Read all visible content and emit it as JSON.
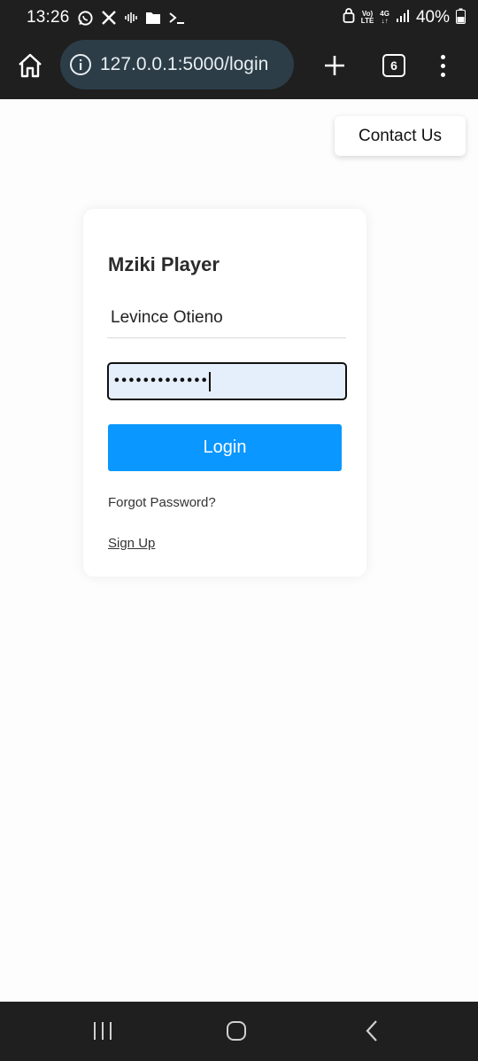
{
  "status_bar": {
    "time": "13:26",
    "network_top": "Vo)",
    "network_bottom": "LTE",
    "net_type": "4G",
    "battery": "40%"
  },
  "browser": {
    "url": "127.0.0.1:5000/login",
    "tab_count": "6"
  },
  "header": {
    "contact_label": "Contact Us"
  },
  "login": {
    "title": "Mziki Player",
    "username_value": "Levince Otieno",
    "password_masked": "•••••••••••••",
    "login_label": "Login",
    "forgot_label": "Forgot Password?",
    "signup_label": "Sign Up"
  },
  "colors": {
    "primary_button": "#0a97ff",
    "password_focus_bg": "#e5eefb",
    "system_bars": "#1f1f1f",
    "url_pill": "#2c3d47"
  },
  "icons": {
    "status_left": [
      "whatsapp-icon",
      "x-icon",
      "voice-wave-icon",
      "folder-icon",
      "terminal-icon"
    ],
    "status_right": [
      "alarm-lock-icon",
      "volte-icon",
      "4g-icon",
      "signal-icon",
      "battery-icon"
    ],
    "toolbar": [
      "home-icon",
      "info-icon",
      "plus-icon",
      "tabs-icon",
      "overflow-menu-icon"
    ],
    "nav": [
      "recent-apps-icon",
      "home-nav-icon",
      "back-icon"
    ]
  }
}
